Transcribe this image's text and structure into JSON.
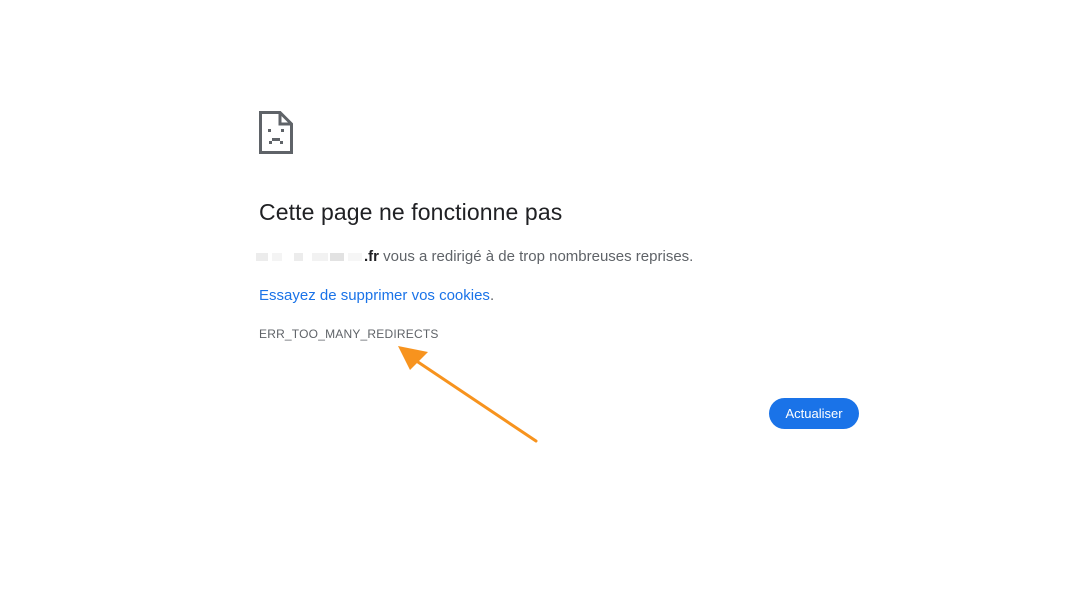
{
  "error": {
    "title": "Cette page ne fonctionne pas",
    "domain_suffix": ".fr",
    "message_text": " vous a redirigé à de trop nombreuses reprises.",
    "suggestion_link": "Essayez de supprimer vos cookies",
    "suggestion_end": ".",
    "code": "ERR_TOO_MANY_REDIRECTS",
    "reload_label": "Actualiser"
  },
  "colors": {
    "accent": "#1a73e8",
    "title": "#202124",
    "body": "#5f6368",
    "annotation_arrow": "#f7931e"
  },
  "icons": {
    "error": "sad-page-icon"
  }
}
